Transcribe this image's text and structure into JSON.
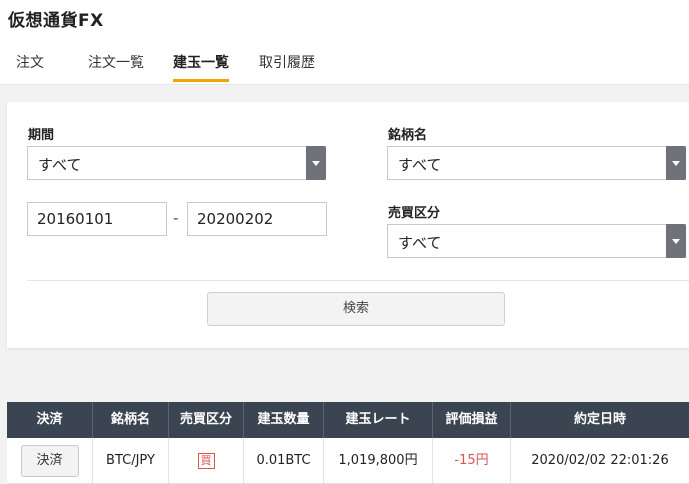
{
  "app": {
    "title": "仮想通貨FX"
  },
  "tabs": [
    {
      "label": "注文"
    },
    {
      "label": "注文一覧"
    },
    {
      "label": "建玉一覧",
      "active": true
    },
    {
      "label": "取引履歴"
    }
  ],
  "filters": {
    "period": {
      "label": "期間",
      "selected": "すべて",
      "from": "20160101",
      "separator": "-",
      "to": "20200202"
    },
    "symbol": {
      "label": "銘柄名",
      "selected": "すべて"
    },
    "side": {
      "label": "売買区分",
      "selected": "すべて"
    },
    "search_label": "検索"
  },
  "table": {
    "headers": [
      "決済",
      "銘柄名",
      "売買区分",
      "建玉数量",
      "建玉レート",
      "評価損益",
      "約定日時"
    ],
    "rows": [
      {
        "action": "決済",
        "symbol": "BTC/JPY",
        "side": "買",
        "quantity": "0.01BTC",
        "rate": "1,019,800円",
        "pnl": "-15円",
        "datetime": "2020/02/02 22:01:26"
      }
    ]
  },
  "colors": {
    "accent": "#f0a500",
    "table_header": "#3b4552",
    "loss": "#d9534f",
    "select_arrow": "#6f7379"
  }
}
